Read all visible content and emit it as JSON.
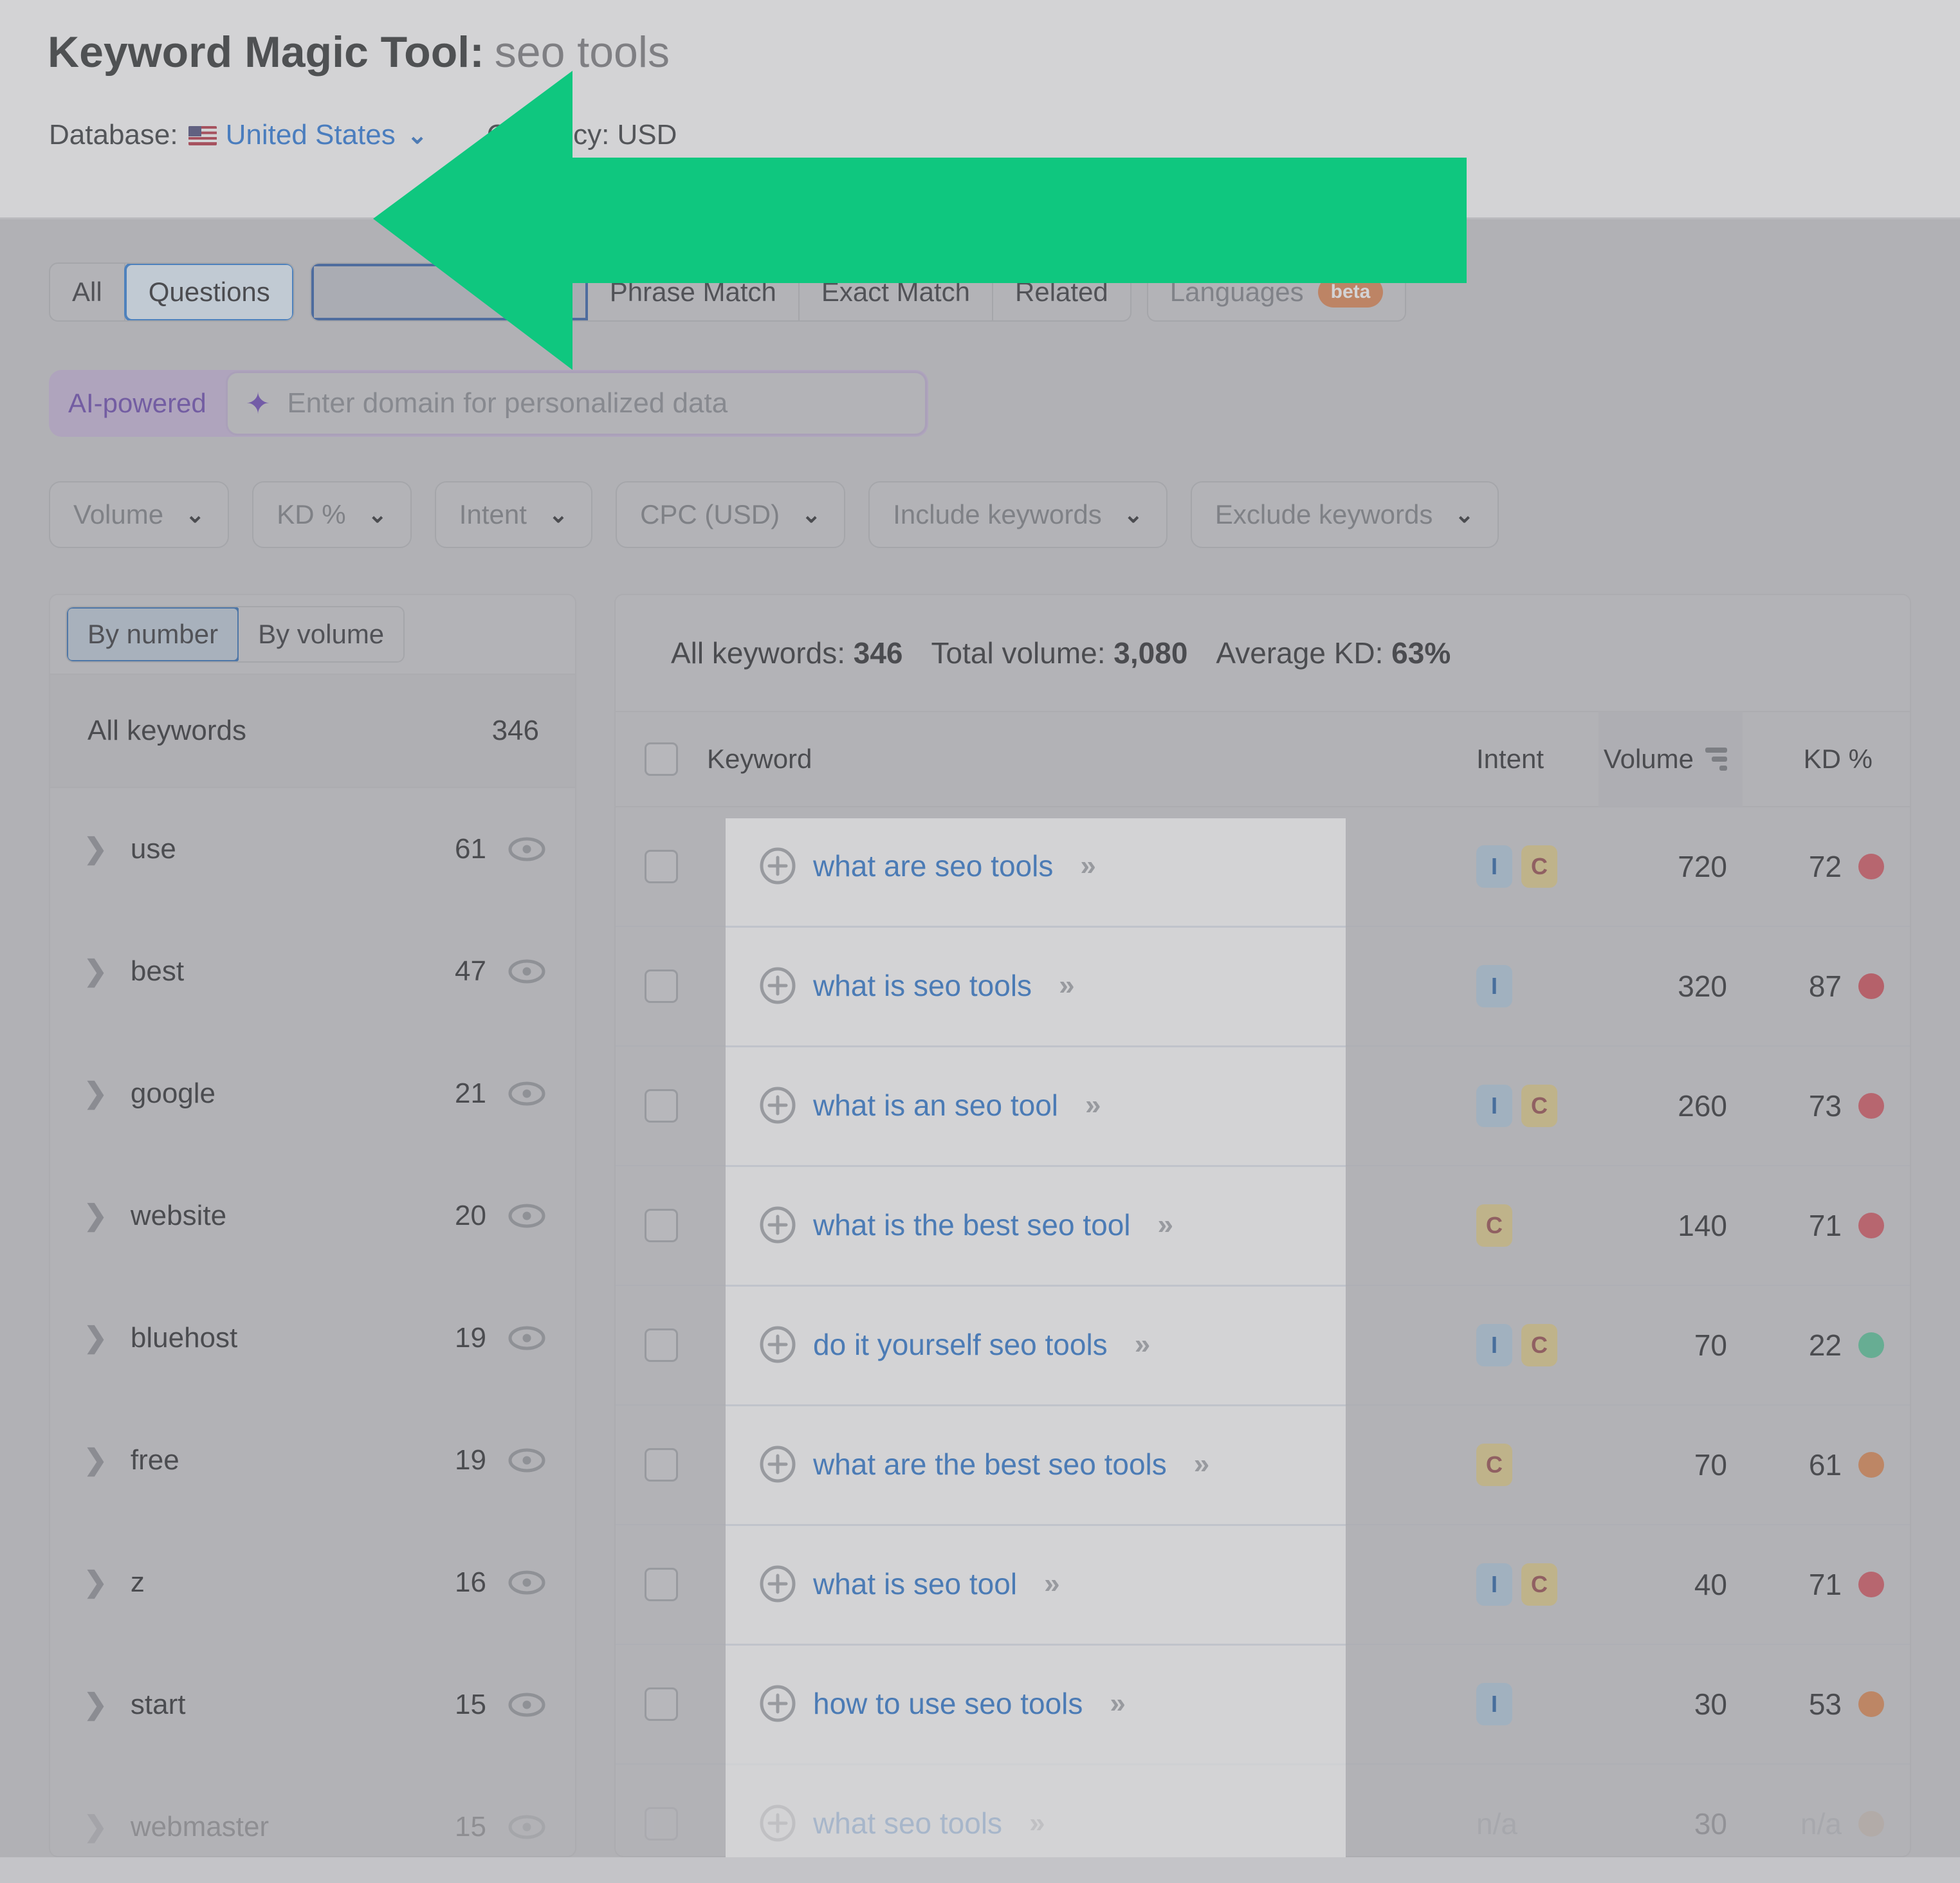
{
  "header": {
    "title": "Keyword Magic Tool:",
    "keyword": "seo tools",
    "database_label": "Database:",
    "database_value": "United States",
    "currency_label": "Currency: USD",
    "flag_icon": "us-flag-icon",
    "chevron_icon": "chevron-down-icon"
  },
  "tabs": {
    "group1": [
      {
        "label": "All",
        "selected": false
      },
      {
        "label": "Questions",
        "selected": true
      }
    ],
    "group2": [
      {
        "label": "",
        "selected": false,
        "outlined": true
      }
    ],
    "group3": [
      {
        "label": "Phrase Match",
        "selected": false
      },
      {
        "label": "Exact Match",
        "selected": false
      },
      {
        "label": "Related",
        "selected": false
      }
    ],
    "group4": [
      {
        "label": "Languages",
        "badge": "beta",
        "dim": true
      }
    ]
  },
  "ai_row": {
    "label": "AI-powered",
    "sparkle_icon": "sparkle-icon",
    "placeholder": "Enter domain for personalized data"
  },
  "filters": [
    {
      "label": "Volume",
      "chevron": "⌄"
    },
    {
      "label": "KD %",
      "chevron": "⌄"
    },
    {
      "label": "Intent",
      "chevron": "⌄"
    },
    {
      "label": "CPC (USD)",
      "chevron": "⌄"
    },
    {
      "label": "Include keywords",
      "chevron": "⌄"
    },
    {
      "label": "Exclude keywords",
      "chevron": "⌄"
    }
  ],
  "sidebar": {
    "segmented": [
      {
        "label": "By number",
        "selected": true
      },
      {
        "label": "By volume",
        "selected": false
      }
    ],
    "all_keywords_label": "All keywords",
    "all_keywords_count": "346",
    "items": [
      {
        "label": "use",
        "count": "61",
        "faded": false
      },
      {
        "label": "best",
        "count": "47",
        "faded": false
      },
      {
        "label": "google",
        "count": "21",
        "faded": false
      },
      {
        "label": "website",
        "count": "20",
        "faded": false
      },
      {
        "label": "bluehost",
        "count": "19",
        "faded": false
      },
      {
        "label": "free",
        "count": "19",
        "faded": false
      },
      {
        "label": "z",
        "count": "16",
        "faded": false
      },
      {
        "label": "start",
        "count": "15",
        "faded": false
      },
      {
        "label": "webmaster",
        "count": "15",
        "faded": true
      }
    ]
  },
  "summary": {
    "all_keywords_label": "All keywords:",
    "all_keywords_value": "346",
    "total_volume_label": "Total volume:",
    "total_volume_value": "3,080",
    "average_kd_label": "Average KD:",
    "average_kd_value": "63%"
  },
  "table": {
    "columns": [
      "Keyword",
      "Intent",
      "Volume",
      "KD %"
    ],
    "sort_column": "Volume",
    "rows": [
      {
        "keyword": "what are seo tools",
        "intent": [
          "I",
          "C"
        ],
        "volume": "720",
        "kd": "72",
        "kd_color": "#cf4450",
        "faded": false
      },
      {
        "keyword": "what is seo tools",
        "intent": [
          "I"
        ],
        "volume": "320",
        "kd": "87",
        "kd_color": "#cc3b48",
        "faded": false
      },
      {
        "keyword": "what is an seo tool",
        "intent": [
          "I",
          "C"
        ],
        "volume": "260",
        "kd": "73",
        "kd_color": "#cf4450",
        "faded": false
      },
      {
        "keyword": "what is the best seo tool",
        "intent": [
          "C"
        ],
        "volume": "140",
        "kd": "71",
        "kd_color": "#cf4450",
        "faded": false
      },
      {
        "keyword": "do it yourself seo tools",
        "intent": [
          "I",
          "C"
        ],
        "volume": "70",
        "kd": "22",
        "kd_color": "#45bd8d",
        "faded": false
      },
      {
        "keyword": "what are the best seo tools",
        "intent": [
          "C"
        ],
        "volume": "70",
        "kd": "61",
        "kd_color": "#d97b3f",
        "faded": false
      },
      {
        "keyword": "what is seo tool",
        "intent": [
          "I",
          "C"
        ],
        "volume": "40",
        "kd": "71",
        "kd_color": "#cf4450",
        "faded": false
      },
      {
        "keyword": "how to use seo tools",
        "intent": [
          "I"
        ],
        "volume": "30",
        "kd": "53",
        "kd_color": "#d97b3f",
        "faded": false
      },
      {
        "keyword": "what seo tools",
        "intent": [],
        "volume": "30",
        "kd": "n/a",
        "kd_color": "#c7a27a",
        "intent_na": "n/a",
        "faded": true
      }
    ],
    "row_expand_icon": "plus-circle-icon",
    "row_arrow_icon": "double-chevron-right-icon"
  },
  "annotation": {
    "arrow_icon": "left-arrow-annotation",
    "color": "#0fc77f"
  },
  "colors": {
    "accent_blue": "#1668c8",
    "selected_tab_border": "#1a73d4",
    "ai_purple": "#5a34a8",
    "annotation_green": "#0fc77f"
  }
}
